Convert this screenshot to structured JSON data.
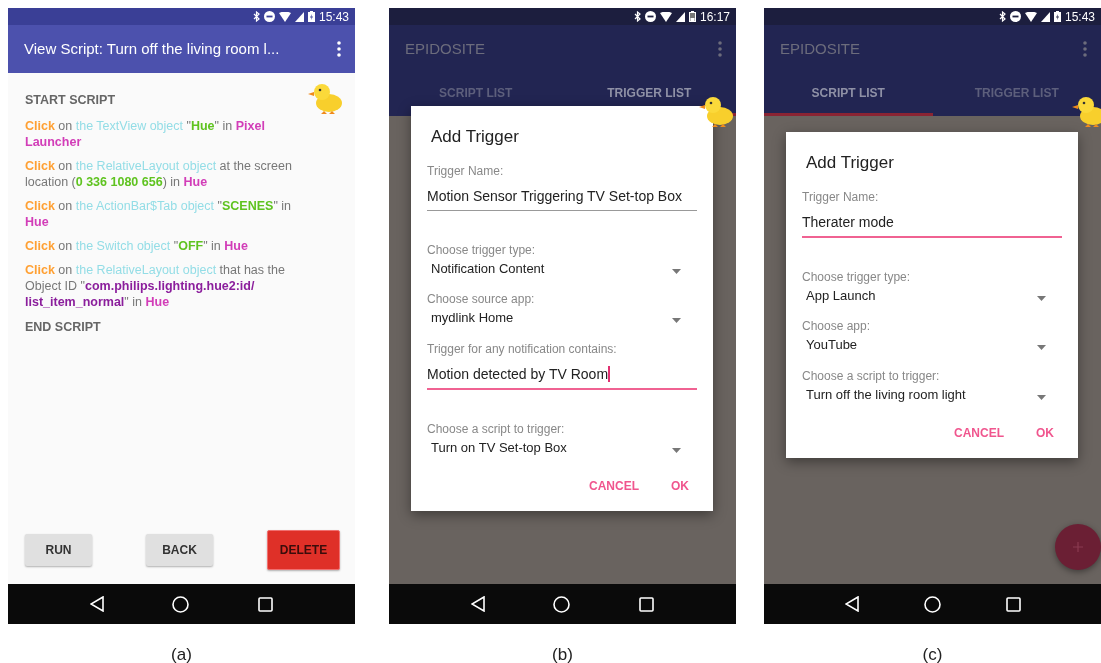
{
  "panels": [
    {
      "kind": "script_view",
      "caption": "(a)",
      "status_bar": {
        "time": "15:43",
        "battery_charging": true
      },
      "app_bar": {
        "title": "View Script: Turn off the living room l..."
      },
      "script": {
        "header": "START SCRIPT",
        "steps": [
          {
            "segments": [
              {
                "kind": "action",
                "text": "Click"
              },
              {
                "kind": "plain",
                "text": " on "
              },
              {
                "kind": "object",
                "text": "the TextView object"
              },
              {
                "kind": "plain",
                "text": " \""
              },
              {
                "kind": "value",
                "text": "Hue"
              },
              {
                "kind": "plain",
                "text": "\" in "
              },
              {
                "kind": "app",
                "text": "Pixel Launcher"
              }
            ]
          },
          {
            "segments": [
              {
                "kind": "action",
                "text": "Click"
              },
              {
                "kind": "plain",
                "text": " on "
              },
              {
                "kind": "object",
                "text": "the RelativeLayout object"
              },
              {
                "kind": "plain",
                "text": " at the screen location ("
              },
              {
                "kind": "value",
                "text": "0 336 1080 656"
              },
              {
                "kind": "plain",
                "text": ") in "
              },
              {
                "kind": "app",
                "text": "Hue"
              }
            ]
          },
          {
            "segments": [
              {
                "kind": "action",
                "text": "Click"
              },
              {
                "kind": "plain",
                "text": " on "
              },
              {
                "kind": "object",
                "text": "the ActionBar$Tab object"
              },
              {
                "kind": "plain",
                "text": " \""
              },
              {
                "kind": "value",
                "text": "SCENES"
              },
              {
                "kind": "plain",
                "text": "\" in "
              },
              {
                "kind": "app",
                "text": "Hue"
              }
            ]
          },
          {
            "segments": [
              {
                "kind": "action",
                "text": "Click"
              },
              {
                "kind": "plain",
                "text": " on "
              },
              {
                "kind": "object",
                "text": "the Switch object"
              },
              {
                "kind": "plain",
                "text": " \""
              },
              {
                "kind": "value",
                "text": "OFF"
              },
              {
                "kind": "plain",
                "text": "\" in "
              },
              {
                "kind": "app",
                "text": "Hue"
              }
            ]
          },
          {
            "segments": [
              {
                "kind": "action",
                "text": "Click"
              },
              {
                "kind": "plain",
                "text": " on "
              },
              {
                "kind": "object",
                "text": "the RelativeLayout object"
              },
              {
                "kind": "plain",
                "text": " that has the Object ID \""
              },
              {
                "kind": "id",
                "text": "com.philips.lighting.hue2:id/ list_item_normal"
              },
              {
                "kind": "plain",
                "text": "\" in "
              },
              {
                "kind": "app",
                "text": "Hue"
              }
            ]
          }
        ],
        "footer": "END SCRIPT"
      },
      "buttons": [
        {
          "kind": "default",
          "label": "RUN"
        },
        {
          "kind": "default",
          "label": "BACK"
        },
        {
          "kind": "danger",
          "label": "DELETE"
        }
      ]
    },
    {
      "kind": "trigger_dialog",
      "caption": "(b)",
      "status_bar": {
        "time": "16:17",
        "battery_charging": false
      },
      "app_bar": {
        "title": "EPIDOSITE"
      },
      "tabs": [
        {
          "label": "SCRIPT LIST",
          "selected": false
        },
        {
          "label": "TRIGGER LIST",
          "selected": true
        }
      ],
      "dialog": {
        "title": "Add Trigger",
        "fields": [
          {
            "kind": "text",
            "label": "Trigger Name:",
            "value": "Motion Sensor Triggering TV Set-top Box",
            "focused": false
          },
          {
            "kind": "select",
            "label": "Choose trigger type:",
            "value": "Notification Content"
          },
          {
            "kind": "select",
            "label": "Choose source app:",
            "value": "mydlink Home"
          },
          {
            "kind": "text",
            "label": "Trigger for any notification contains:",
            "value": "Motion detected by TV Room",
            "focused": true,
            "cursor": true
          },
          {
            "kind": "select",
            "label": "Choose a script to trigger:",
            "value": "Turn on TV Set-top Box"
          }
        ],
        "actions": [
          "CANCEL",
          "OK"
        ]
      },
      "fab": false
    },
    {
      "kind": "trigger_dialog",
      "caption": "(c)",
      "status_bar": {
        "time": "15:43",
        "battery_charging": true
      },
      "app_bar": {
        "title": "EPIDOSITE"
      },
      "tabs": [
        {
          "label": "SCRIPT LIST",
          "selected": true
        },
        {
          "label": "TRIGGER LIST",
          "selected": false
        }
      ],
      "dialog": {
        "title": "Add Trigger",
        "fields": [
          {
            "kind": "text",
            "label": "Trigger Name:",
            "value": "Therater mode",
            "focused": true
          },
          {
            "kind": "select",
            "label": "Choose trigger type:",
            "value": "App Launch"
          },
          {
            "kind": "select",
            "label": "Choose app:",
            "value": "YouTube"
          },
          {
            "kind": "select",
            "label": "Choose a script to trigger:",
            "value": "Turn off the living room light"
          }
        ],
        "actions": [
          "CANCEL",
          "OK"
        ]
      },
      "fab": true
    }
  ]
}
